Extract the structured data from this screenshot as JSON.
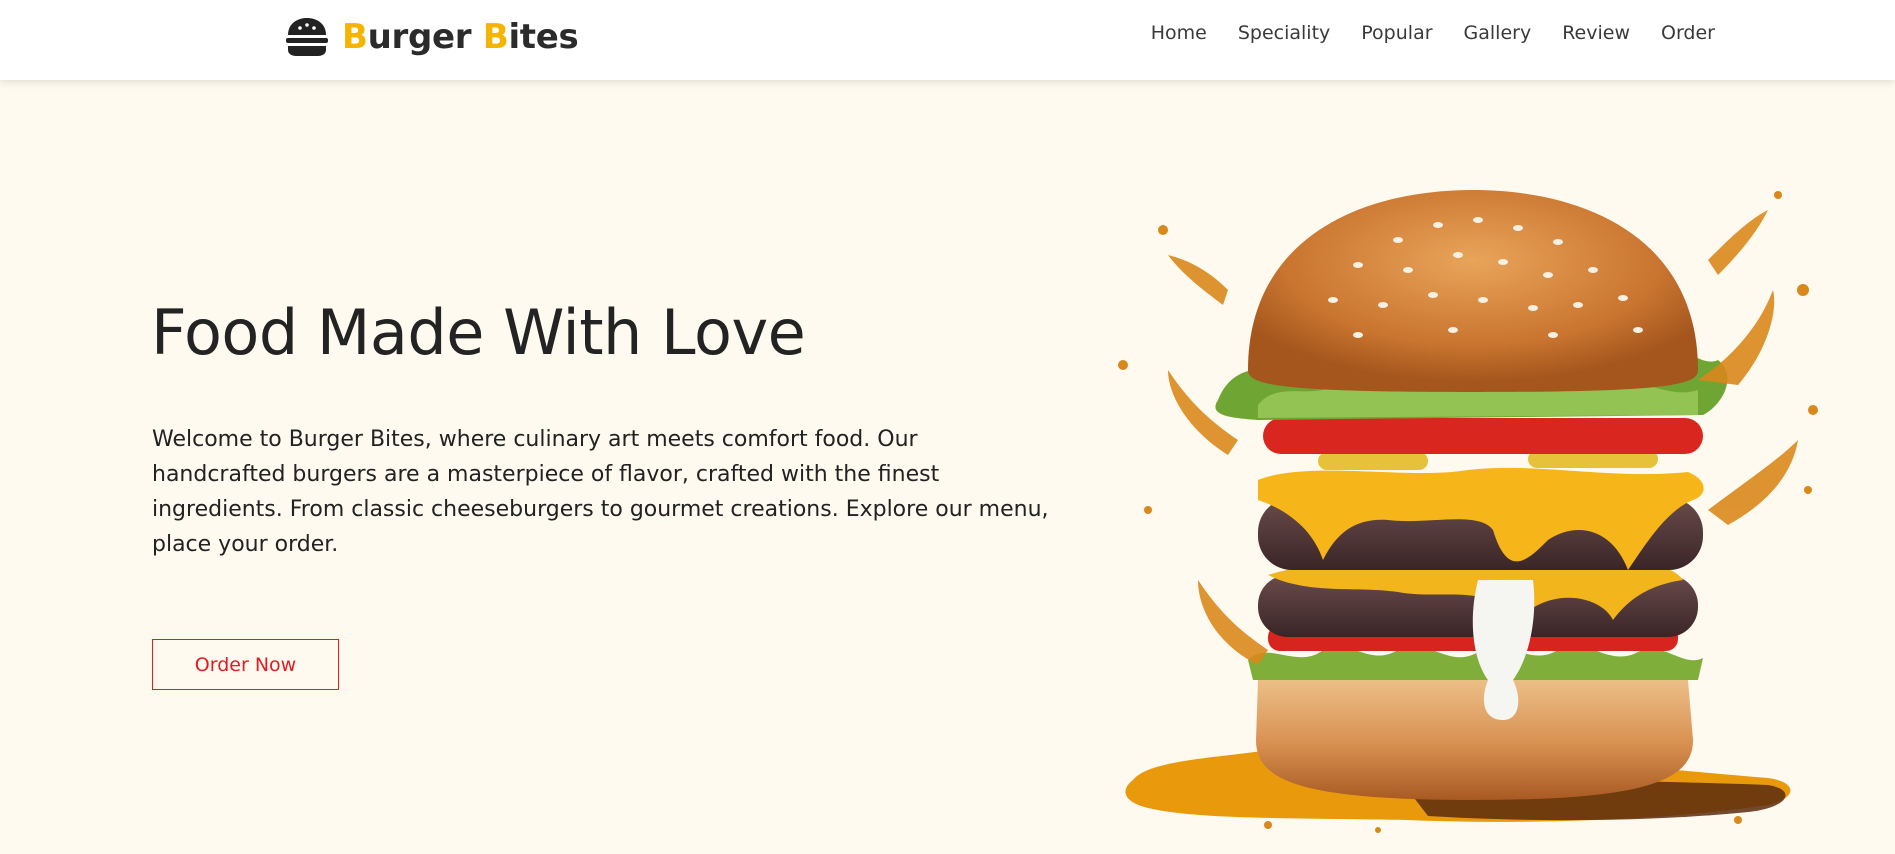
{
  "brand": {
    "name_first_initial": "B",
    "name_first_rest": "urger ",
    "name_second_initial": "B",
    "name_second_rest": "ites",
    "accent_color": "#f4b400"
  },
  "nav": {
    "items": [
      {
        "label": "Home"
      },
      {
        "label": "Speciality"
      },
      {
        "label": "Popular"
      },
      {
        "label": "Gallery"
      },
      {
        "label": "Review"
      },
      {
        "label": "Order"
      }
    ]
  },
  "hero": {
    "title": "Food Made With Love",
    "description": "Welcome to Burger Bites, where culinary art meets comfort food. Our handcrafted burgers are a masterpiece of flavor, crafted with the finest ingredients. From classic cheeseburgers to gourmet creations. Explore our menu, place your order.",
    "cta_label": "Order Now",
    "cta_color": "#e31b23",
    "background_color": "#fefaf0"
  },
  "icons": {
    "logo": "burger-icon",
    "hero_image": "burger-splash-image"
  }
}
